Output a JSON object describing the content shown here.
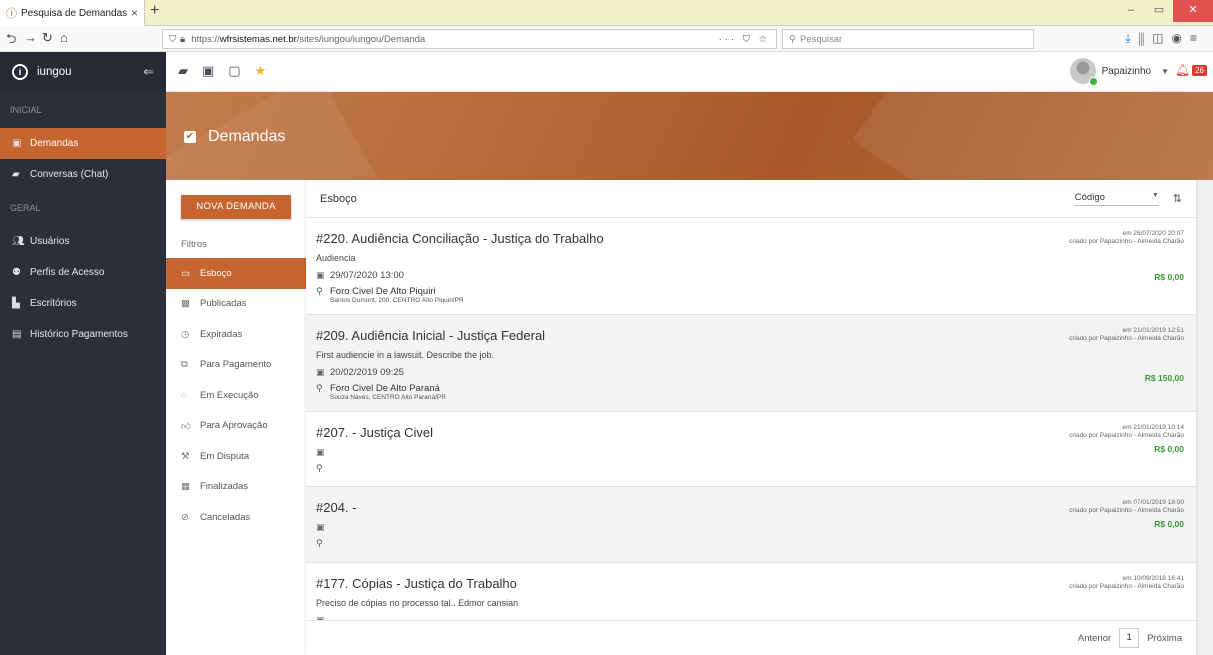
{
  "browser": {
    "tab_title": "Pesquisa de Demandas",
    "tab_close": "×",
    "new_tab": "+",
    "url_prefix": "https://",
    "url_domain": "wfrsistemas.net.br",
    "url_path": "/sites/iungou/iungou/Demanda",
    "url_actions": "··· ⛉ ☆",
    "search_placeholder": "Pesquisar"
  },
  "sidebar": {
    "brand": "iungou",
    "sections": [
      {
        "label": "INICIAL",
        "items": [
          {
            "label": "Demandas",
            "icon": "calendar-icon",
            "active": true
          },
          {
            "label": "Conversas (Chat)",
            "icon": "chat-icon",
            "active": false
          }
        ]
      },
      {
        "label": "GERAL",
        "items": [
          {
            "label": "Usuários",
            "icon": "users-icon",
            "active": false
          },
          {
            "label": "Perfis de Acesso",
            "icon": "profile-icon",
            "active": false
          },
          {
            "label": "Escritórios",
            "icon": "office-icon",
            "active": false
          },
          {
            "label": "Histórico Pagamentos",
            "icon": "payments-icon",
            "active": false
          }
        ]
      }
    ]
  },
  "header": {
    "user_name": "Papaizinho",
    "notifications": "26"
  },
  "hero": {
    "title": "Demandas"
  },
  "filters": {
    "new_button": "NOVA DEMANDA",
    "label": "Filtros",
    "items": [
      {
        "label": "Esboço",
        "icon": "draft-icon",
        "active": true
      },
      {
        "label": "Publicadas",
        "icon": "published-icon",
        "active": false
      },
      {
        "label": "Expiradas",
        "icon": "clock-icon",
        "active": false
      },
      {
        "label": "Para Pagamento",
        "icon": "copy-icon",
        "active": false
      },
      {
        "label": "Em Execução",
        "icon": "spinner-icon",
        "active": false
      },
      {
        "label": "Para Aprovação",
        "icon": "thumbs-up-icon",
        "active": false
      },
      {
        "label": "Em Disputa",
        "icon": "gavel-icon",
        "active": false
      },
      {
        "label": "Finalizadas",
        "icon": "briefcase-icon",
        "active": false
      },
      {
        "label": "Canceladas",
        "icon": "cancel-icon",
        "active": false
      }
    ]
  },
  "main": {
    "title": "Esboço",
    "sort_label": "Código",
    "demands": [
      {
        "title": "#220. Audiência Conciliação - Justiça do Trabalho",
        "description": "Audiencia",
        "date": "29/07/2020 13:00",
        "location": "Foro Civel De Alto Piquiri",
        "address": "Santos Dumont, 200, CENTRO Alto Piquiri/PR",
        "meta_date": "em 26/07/2020 20:07",
        "meta_author": "criado por Papaizinho - Almeida Charão",
        "price": "R$ 0,00"
      },
      {
        "title": "#209. Audiência Inicial - Justiça Federal",
        "description": "First audiencie in a lawsuit. Describe the job.",
        "date": "20/02/2019 09:25",
        "location": "Foro Civel De Alto Paraná",
        "address": "Souza Naves, CENTRO Alto Paraná/PR",
        "meta_date": "em 21/01/2019 12:51",
        "meta_author": "criado por Papaizinho - Almeida Charão",
        "price": "R$ 150,00"
      },
      {
        "title": "#207. - Justiça Civel",
        "description": "",
        "date": "",
        "location": "",
        "address": "",
        "meta_date": "em 21/01/2019 10:14",
        "meta_author": "criado por Papaizinho - Almeida Charão",
        "price": "R$ 0,00"
      },
      {
        "title": "#204. -",
        "description": "",
        "date": "",
        "location": "",
        "address": "",
        "meta_date": "em 07/01/2019 18:00",
        "meta_author": "criado por Papaizinho - Almeida Charão",
        "price": "R$ 0,00"
      },
      {
        "title": "#177. Cópias - Justiça do Trabalho",
        "description": "Preciso de cópias no processo tal.. Edmor cansian",
        "date": "",
        "location": "",
        "address": "",
        "meta_date": "em 10/09/2018 16:41",
        "meta_author": "criado por Papaizinho - Almeida Charão",
        "price": ""
      }
    ],
    "pagination": {
      "prev": "Anterior",
      "page": "1",
      "next": "Próxima"
    }
  }
}
